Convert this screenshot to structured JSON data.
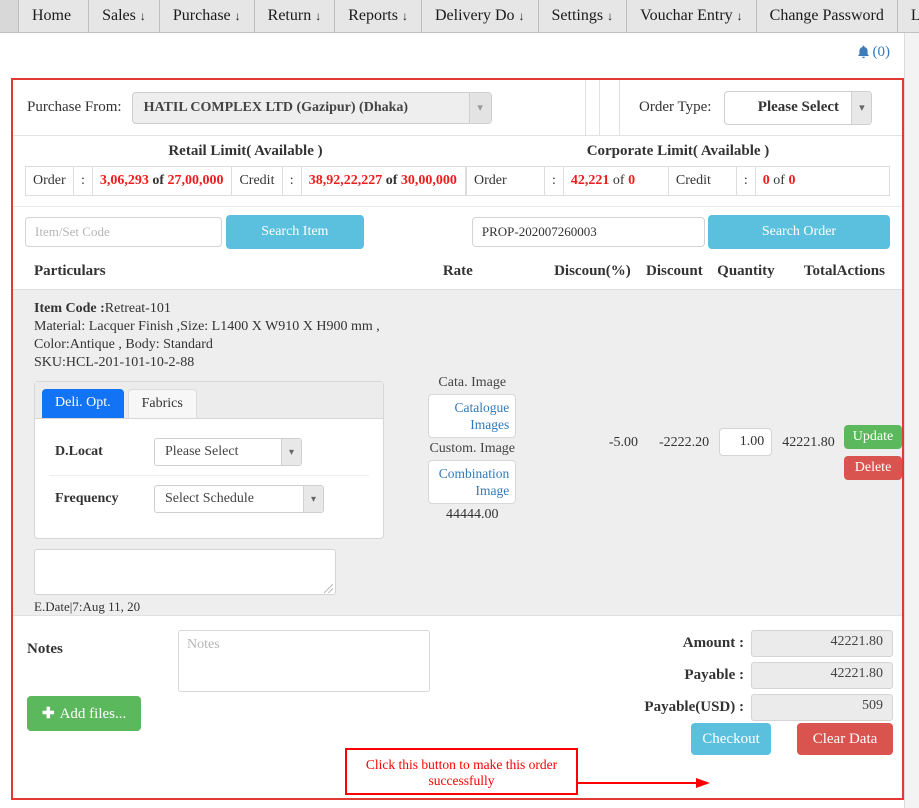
{
  "nav": {
    "items": [
      {
        "label": "Home",
        "caret": ""
      },
      {
        "label": "Sales",
        "caret": "↓"
      },
      {
        "label": "Purchase",
        "caret": "↓"
      },
      {
        "label": "Return",
        "caret": "↓"
      },
      {
        "label": "Reports",
        "caret": "↓"
      },
      {
        "label": "Delivery Do",
        "caret": "↓"
      },
      {
        "label": "Settings",
        "caret": "↓"
      },
      {
        "label": "Vouchar Entry",
        "caret": "↓"
      },
      {
        "label": "Change Password",
        "caret": ""
      },
      {
        "label": "Log Out",
        "caret": ""
      }
    ]
  },
  "notification": {
    "count_label": "(0)"
  },
  "top_form": {
    "purchase_from_label": "Purchase From:",
    "purchase_from_value": "HATIL COMPLEX LTD (Gazipur) (Dhaka)",
    "order_type_label": "Order Type:",
    "order_type_value": "Please Select"
  },
  "limits": {
    "retail": {
      "title": "Retail Limit( Available )",
      "rows": [
        {
          "label": "Order",
          "colon": ":",
          "used": "3,06,293",
          "of": "of",
          "total": "27,00,000"
        },
        {
          "label": "Credit",
          "colon": ":",
          "used": "38,92,22,227",
          "of": "of",
          "total": "30,00,000"
        }
      ]
    },
    "corporate": {
      "title": "Corporate Limit( Available )",
      "rows": [
        {
          "label": "Order",
          "colon": ":",
          "used": "42,221",
          "of": "of",
          "total": "0"
        },
        {
          "label": "Credit",
          "colon": ":",
          "used": "0",
          "of": "of",
          "total": "0"
        }
      ]
    }
  },
  "search": {
    "item_placeholder": "Item/Set Code",
    "item_value": "",
    "search_item_label": "Search Item",
    "order_value": "PROP-202007260003",
    "search_order_label": "Search Order"
  },
  "table": {
    "headers": {
      "particulars": "Particulars",
      "rate": "Rate",
      "discount_pct": "Discoun(%)",
      "discount": "Discount",
      "quantity": "Quantity",
      "total": "Total",
      "actions": "Actions"
    },
    "row": {
      "item_code_label": "Item Code :",
      "item_code": "Retreat-101",
      "material_line": "Material: Lacquer Finish ,Size: L1400 X W910 X H900 mm ,",
      "color_line": "Color:Antique , Body: Standard",
      "sku_line": "SKU:HCL-201-101-10-2-88",
      "tabs": [
        {
          "label": "Deli. Opt.",
          "active": true
        },
        {
          "label": "Fabrics",
          "active": false
        }
      ],
      "dlocat_label": "D.Locat",
      "dlocat_value": "Please Select",
      "frequency_label": "Frequency",
      "frequency_value": "Select Schedule",
      "remark_value": "",
      "edate": "E.Date|7:Aug 11, 20",
      "cata_image_caption": "Cata. Image",
      "cata_image_button": "Catalogue Images",
      "custom_image_caption": "Custom. Image",
      "custom_image_button": "Combination Image",
      "rate": "44444.00",
      "discount_pct": "-5.00",
      "discount": "-2222.20",
      "quantity": "1.00",
      "total": "42221.80",
      "update_label": "Update",
      "delete_label": "Delete"
    }
  },
  "footer": {
    "notes_label": "Notes",
    "notes_placeholder": "Notes",
    "notes_value": "",
    "add_files_label": "Add files...",
    "amount_label": "Amount :",
    "amount_value": "42221.80",
    "payable_label": "Payable :",
    "payable_value": "42221.80",
    "payable_usd_label": "Payable(USD) :",
    "payable_usd_value": "509",
    "checkout_label": "Checkout",
    "clear_data_label": "Clear Data"
  },
  "annotation": {
    "text": "Click this button to make this order successfully",
    "color": "#ff0000"
  },
  "colors": {
    "accent_info": "#5bc0de",
    "success": "#5cb85c",
    "danger": "#d9534f",
    "tab_active": "#1273f5",
    "limit_red": "#ee1c1c",
    "panel_border": "#e03a34",
    "link_blue": "#337ab7"
  }
}
